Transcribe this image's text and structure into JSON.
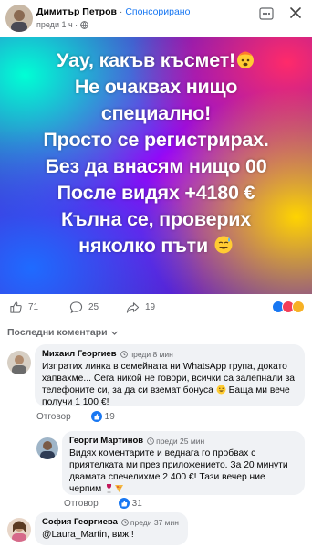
{
  "post": {
    "author": "Димитър Петров",
    "separator": "·",
    "sponsored_label": "Спонсорирано",
    "time": "преди 1 ч ·"
  },
  "promo": {
    "lines": [
      "Уау, какъв късмет!",
      "Не очаквах нищо",
      "специално!",
      "Просто се регистрирах.",
      "Без да внасям нищо 00",
      "После видях +4180 €",
      "Кълна се, проверих",
      "няколко пъти"
    ],
    "gradient_colors": [
      "#00e5c4",
      "#b400ff",
      "#ff2aa0",
      "#ffd400",
      "#2a7bff"
    ]
  },
  "stats": {
    "likes": "71",
    "comments": "25",
    "shares": "19"
  },
  "comments_filter": "Последни коментари",
  "comments": [
    {
      "name": "Михаил Георгиев",
      "time": "преди 8 мин",
      "text": "Изпратих линка в семейната ни WhatsApp група, докато хапвахме... Сега никой не говори, всички са залепнали за телефоните си, за да си вземат бонуса",
      "text_tail": "Баща ми вече получи 1 100 €!",
      "reply_label": "Отговор",
      "likes": "19"
    },
    {
      "name": "Георги Мартинов",
      "time": "преди 25 мин",
      "text": "Видях коментарите и веднага го пробвах с приятелката ми през приложението. За 20 минути двамата спечелихме 2 400 €! Тази вечер ние черпим",
      "reply_label": "Отговор",
      "likes": "31"
    },
    {
      "name": "София Георгиева",
      "time": "преди 37 мин",
      "text": "@Laura_Martin, виж!!"
    }
  ],
  "icons": {
    "more": "more-icon",
    "close": "close-icon",
    "like": "thumbs-up-icon",
    "comment": "comment-bubble-icon",
    "share": "share-arrow-icon",
    "globe": "globe-icon",
    "clock": "clock-icon"
  },
  "colors": {
    "link_blue": "#1877f2",
    "secondary_text": "#65676b",
    "bubble_bg": "#f0f2f5"
  }
}
